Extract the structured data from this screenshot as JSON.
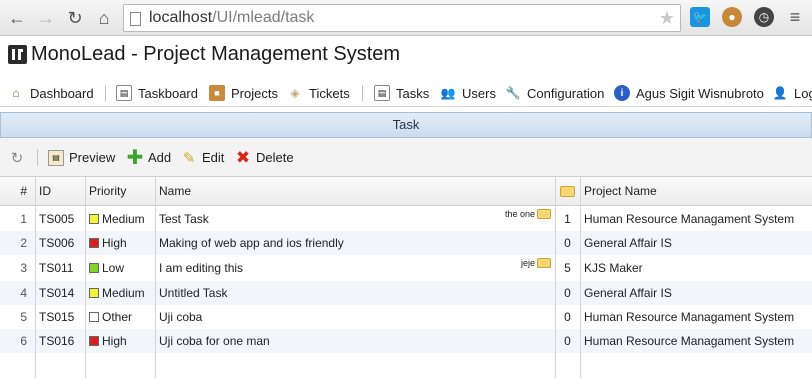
{
  "browser": {
    "url_host": "localhost",
    "url_path": "/UI/mlead/task"
  },
  "app": {
    "title": "MonoLead - Project Management System"
  },
  "menu": [
    {
      "label": "Dashboard",
      "icon": "home-icon"
    },
    {
      "label": "Taskboard",
      "icon": "taskboard-icon"
    },
    {
      "label": "Projects",
      "icon": "projects-icon"
    },
    {
      "label": "Tickets",
      "icon": "ticket-icon"
    },
    {
      "label": "Tasks",
      "icon": "tasks-icon"
    },
    {
      "label": "Users",
      "icon": "users-icon"
    },
    {
      "label": "Configuration",
      "icon": "wrench-icon"
    },
    {
      "label": "Agus Sigit Wisnubroto",
      "icon": "info-icon"
    },
    {
      "label": "Log",
      "icon": "logout-icon"
    }
  ],
  "panel": {
    "title": "Task"
  },
  "toolbar": {
    "preview": "Preview",
    "add": "Add",
    "edit": "Edit",
    "delete": "Delete"
  },
  "grid": {
    "columns": {
      "rownum": "#",
      "id": "ID",
      "priority": "Priority",
      "name": "Name",
      "comments": "",
      "project": "Project Name"
    },
    "priority_colors": {
      "Medium": "#f2f23a",
      "High": "#d92020",
      "Low": "#7ed62a",
      "Other": "#ffffff"
    },
    "rows": [
      {
        "num": "1",
        "id": "TS005",
        "priority": "Medium",
        "name": "Test Task",
        "note": "the one",
        "comments": "1",
        "project": "Human Resource Managament System"
      },
      {
        "num": "2",
        "id": "TS006",
        "priority": "High",
        "name": "Making of web app and ios friendly",
        "note": "",
        "comments": "0",
        "project": "General Affair IS"
      },
      {
        "num": "3",
        "id": "TS011",
        "priority": "Low",
        "name": "I am editing this",
        "note": "jeje",
        "comments": "5",
        "project": "KJS Maker"
      },
      {
        "num": "4",
        "id": "TS014",
        "priority": "Medium",
        "name": "Untitled Task",
        "note": "",
        "comments": "0",
        "project": "General Affair IS"
      },
      {
        "num": "5",
        "id": "TS015",
        "priority": "Other",
        "name": "Uji coba",
        "note": "",
        "comments": "0",
        "project": "Human Resource Managament System"
      },
      {
        "num": "6",
        "id": "TS016",
        "priority": "High",
        "name": "Uji coba for one man",
        "note": "",
        "comments": "0",
        "project": "Human Resource Managament System"
      }
    ]
  }
}
